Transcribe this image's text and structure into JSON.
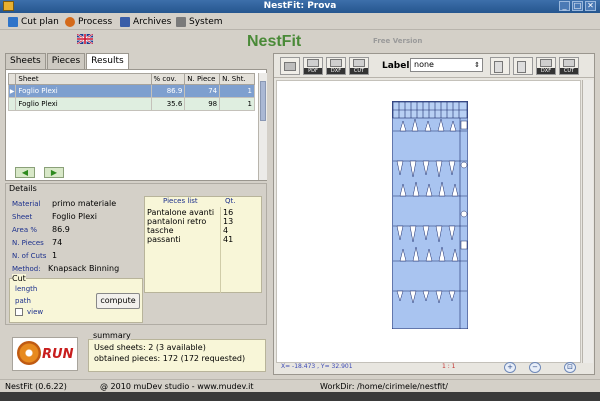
{
  "window": {
    "title": "NestFit: Prova",
    "close_glyph": "✕"
  },
  "menu": [
    {
      "label": "Cut plan",
      "icon": "cut-plan-icon",
      "color": "#2f74c9"
    },
    {
      "label": "Process",
      "icon": "process-icon",
      "color": "#d46a1a"
    },
    {
      "label": "Archives",
      "icon": "archives-icon",
      "color": "#3a5ea8"
    },
    {
      "label": "System",
      "icon": "system-icon",
      "color": "#7a7a7a"
    }
  ],
  "header": {
    "brand": "NestFit",
    "edition": "Free Version",
    "language": "uk-flag-icon"
  },
  "tabs": [
    "Sheets",
    "Pieces",
    "Results"
  ],
  "results": {
    "columns": [
      "Sheet",
      "% cov.",
      "N. Piece",
      "N. Sht."
    ],
    "rows": [
      {
        "sheet": "Foglio Plexi",
        "cov": "86.9",
        "pieces": "74",
        "sheets": "1",
        "selected": true
      },
      {
        "sheet": "Foglio Plexi",
        "cov": "35.6",
        "pieces": "98",
        "sheets": "1",
        "selected": false
      }
    ]
  },
  "details": {
    "title": "Details",
    "fields": [
      {
        "key": "Material",
        "value": "primo materiale"
      },
      {
        "key": "Sheet",
        "value": "Foglio Plexi"
      },
      {
        "key": "Area %",
        "value": "86.9"
      },
      {
        "key": "N. Pieces",
        "value": "74"
      },
      {
        "key": "N. of Cuts",
        "value": "1"
      },
      {
        "key": "Method:",
        "value": "Knapsack Binning"
      }
    ],
    "pieces_header": "Pieces list",
    "qty_header": "Qt.",
    "pieces_list": [
      {
        "name": "Pantalone avanti",
        "qty": "16"
      },
      {
        "name": "pantaloni retro",
        "qty": "13"
      },
      {
        "name": "tasche",
        "qty": "4"
      },
      {
        "name": "passanti",
        "qty": "41"
      }
    ]
  },
  "cut": {
    "title": "Cut",
    "length_label": "length",
    "path_label": "path",
    "view_label": "view",
    "compute_label": "compute"
  },
  "run": {
    "label": "RUN"
  },
  "summary": {
    "title": "summary",
    "used_sheets": "Used sheets: 2 (3 available)",
    "obtained": "obtained pieces: 172 (172 requested)"
  },
  "viewer": {
    "toolbar": [
      {
        "name": "print",
        "tag": ""
      },
      {
        "name": "pdf",
        "tag": "PDF"
      },
      {
        "name": "dxf",
        "tag": "DXF"
      },
      {
        "name": "cut",
        "tag": "CUT"
      }
    ],
    "toolbar_right": [
      {
        "name": "layout-a",
        "tag": ""
      },
      {
        "name": "layout-b",
        "tag": ""
      },
      {
        "name": "dxf-cut",
        "tag": "DXF"
      },
      {
        "name": "cut-export",
        "tag": "CUT"
      }
    ],
    "label_caption": "Label",
    "label_value": "none",
    "coords": "X= -18.473 , Y= 32.901",
    "scale": "1 : 1"
  },
  "status": {
    "version": "NestFit (0.6.22)",
    "copyright": "@ 2010 muDev studio - www.mudev.it",
    "workdir": "WorkDir: /home/cirimele/nestfit/"
  }
}
